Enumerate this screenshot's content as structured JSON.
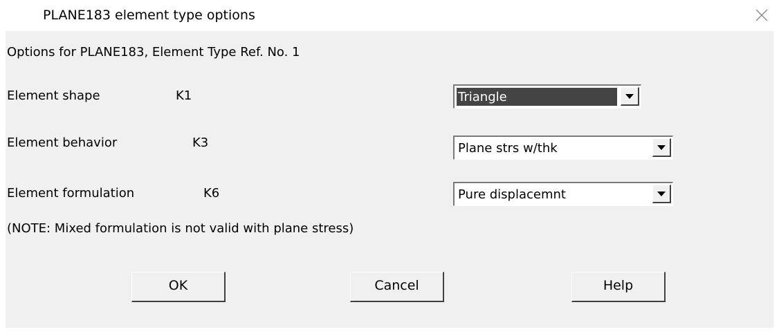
{
  "window": {
    "title": "PLANE183 element type options",
    "close_icon": "close-icon"
  },
  "dialog": {
    "heading": "Options for PLANE183, Element Type Ref. No. 1",
    "options": [
      {
        "label": "Element shape",
        "key": "K1",
        "value": "Triangle",
        "focused": true
      },
      {
        "label": "Element behavior",
        "key": "K3",
        "value": "Plane strs w/thk",
        "focused": false
      },
      {
        "label": "Element formulation",
        "key": "K6",
        "value": "Pure displacemnt",
        "focused": false
      }
    ],
    "note": "(NOTE: Mixed formulation is not valid with plane stress)"
  },
  "buttons": {
    "ok": "OK",
    "cancel": "Cancel",
    "help": "Help"
  },
  "colors": {
    "dialog_background": "#f0f0f0",
    "selection_highlight": "#444444"
  }
}
